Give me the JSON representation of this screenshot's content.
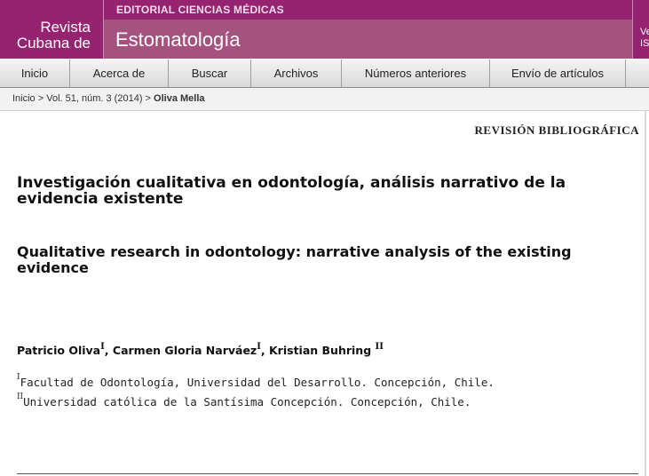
{
  "header": {
    "brand_line1": "Revista",
    "brand_line2": "Cubana de",
    "publisher": "EDITORIAL CIENCIAS MÉDICAS",
    "journal": "Estomatología",
    "edge_text1": "Ve",
    "edge_text2": "IS"
  },
  "nav": {
    "items": [
      "Inicio",
      "Acerca de",
      "Buscar",
      "Archivos",
      "Números anteriores",
      "Envío de artículos"
    ]
  },
  "breadcrumb": {
    "home": "Inicio",
    "sep": ">",
    "issue": "Vol. 51, núm. 3 (2014)",
    "current": "Oliva Mella"
  },
  "article": {
    "section": "REVISIÓN BIBLIOGRÁFICA",
    "title_es": "Investigación cualitativa en odontología, análisis narrativo de la evidencia existente",
    "title_en": "Qualitative research in odontology: narrative analysis of the existing evidence",
    "authors": [
      {
        "name": "Patricio Oliva",
        "sup": "I"
      },
      {
        "name": "Carmen Gloria Narváez",
        "sup": "I"
      },
      {
        "name": "Kristian Buhring",
        "sup": "II"
      }
    ],
    "author_sep": ",",
    "affiliations": [
      {
        "mark": "I",
        "text": "Facultad de Odontología, Universidad del Desarrollo. Concepción, Chile."
      },
      {
        "mark": "II",
        "text": "Universidad católica de la Santísima Concepción. Concepción, Chile."
      }
    ]
  },
  "colors": {
    "brand_purple": "#95236f",
    "journal_bar": "#a5527f"
  }
}
